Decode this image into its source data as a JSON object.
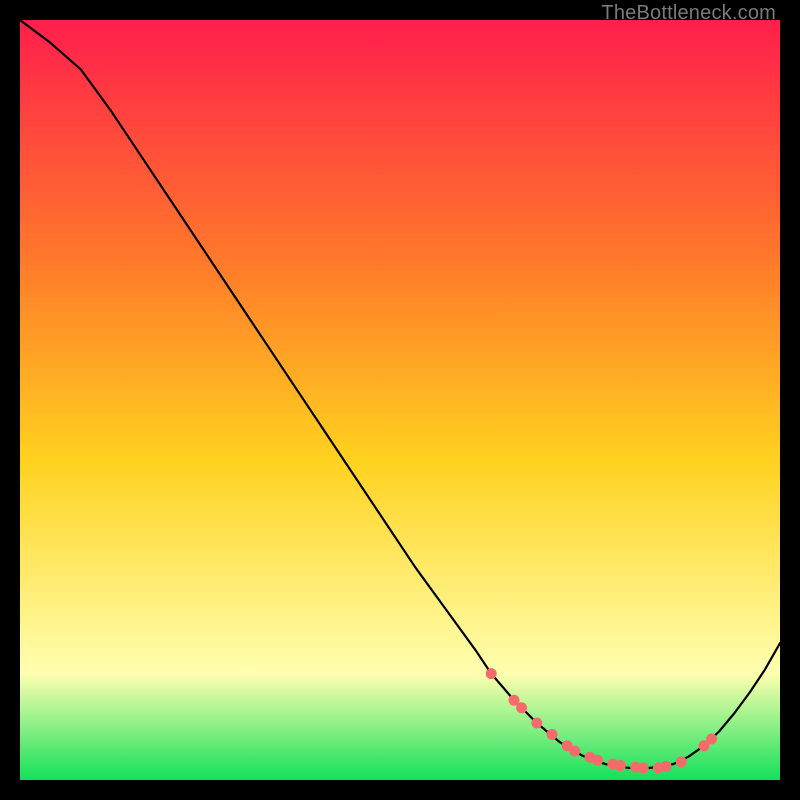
{
  "watermark": "TheBottleneck.com",
  "colors": {
    "grad_top": "#ff1e4c",
    "grad_mid1": "#ff7a2a",
    "grad_mid2": "#ffd21f",
    "grad_mid3": "#ffffb0",
    "grad_bot": "#13e05a",
    "line": "#000000",
    "dots": "#f56b6b",
    "frame": "#000000"
  },
  "chart_data": {
    "type": "line",
    "title": "",
    "xlabel": "",
    "ylabel": "",
    "xlim": [
      0,
      100
    ],
    "ylim": [
      0,
      100
    ],
    "legend": false,
    "grid": false,
    "series": [
      {
        "name": "curve",
        "x": [
          0,
          4,
          8,
          12,
          16,
          20,
          24,
          28,
          32,
          36,
          40,
          44,
          48,
          52,
          56,
          60,
          62,
          65,
          68,
          71,
          74,
          77,
          80,
          83,
          86,
          88,
          90,
          92,
          94,
          96,
          98,
          100
        ],
        "y": [
          100,
          97,
          93.5,
          88,
          82,
          76,
          70,
          64,
          58,
          52,
          46,
          40,
          34,
          28,
          22.5,
          17,
          14,
          10.5,
          7.5,
          5,
          3.2,
          2.1,
          1.6,
          1.6,
          2.1,
          3.1,
          4.5,
          6.4,
          8.8,
          11.5,
          14.5,
          18
        ]
      }
    ],
    "scatter": {
      "name": "bottom-dots",
      "x": [
        62,
        65,
        66,
        68,
        70,
        72,
        73,
        75,
        76,
        78,
        79,
        81,
        82,
        84,
        85,
        87,
        90,
        91
      ],
      "y": [
        14,
        10.5,
        9.5,
        7.5,
        6.0,
        4.5,
        3.8,
        3.0,
        2.6,
        2.1,
        1.9,
        1.7,
        1.6,
        1.6,
        1.8,
        2.4,
        4.5,
        5.4
      ]
    }
  }
}
